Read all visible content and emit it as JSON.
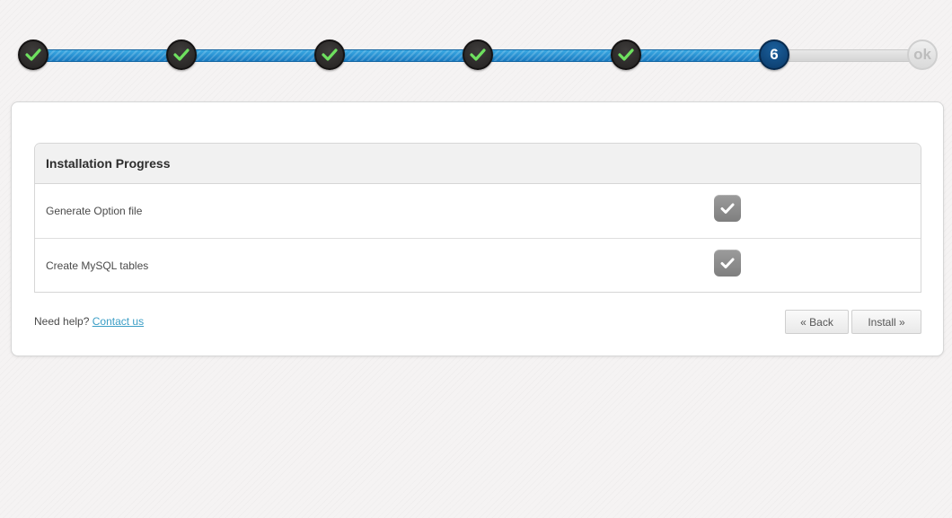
{
  "wizard": {
    "steps": [
      {
        "state": "done",
        "label": ""
      },
      {
        "state": "done",
        "label": ""
      },
      {
        "state": "done",
        "label": ""
      },
      {
        "state": "done",
        "label": ""
      },
      {
        "state": "done",
        "label": ""
      },
      {
        "state": "current",
        "label": "6"
      },
      {
        "state": "pending",
        "label": "ok"
      }
    ],
    "progress_fraction": 0.8333,
    "colors": {
      "progress_fill": "#1679bf",
      "done_step": "#2a2827",
      "current_step": "#0f4a80",
      "checkmark": "#6ee05f"
    }
  },
  "progress_table": {
    "title": "Installation Progress",
    "rows": [
      {
        "label": "Generate Option file",
        "status_icon": "check-icon",
        "done": true
      },
      {
        "label": "Create MySQL tables",
        "status_icon": "check-icon",
        "done": true
      }
    ]
  },
  "footer": {
    "help_text": "Need help?",
    "contact_link": "Contact us",
    "back_label": "« Back",
    "install_label": "Install »"
  }
}
